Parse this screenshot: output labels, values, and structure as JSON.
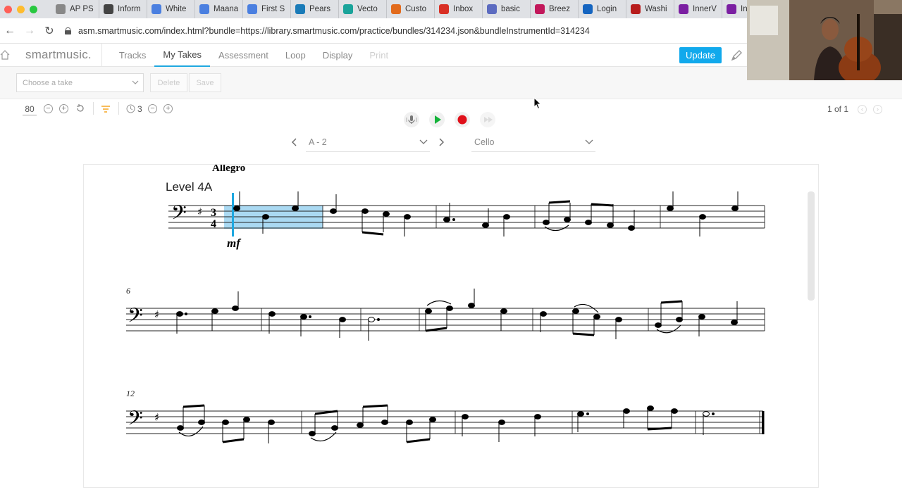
{
  "browser": {
    "tabs": [
      {
        "label": "AP PS",
        "icon": "gear-icon",
        "color": "#888888"
      },
      {
        "label": "Inform",
        "icon": "classroom-icon",
        "color": "#444444"
      },
      {
        "label": "White",
        "icon": "doc-icon",
        "color": "#4a7fe0"
      },
      {
        "label": "Maana",
        "icon": "doc-icon",
        "color": "#4a7fe0"
      },
      {
        "label": "First S",
        "icon": "doc-icon",
        "color": "#4a7fe0"
      },
      {
        "label": "Pears",
        "icon": "pearson-icon",
        "color": "#1a7bb8"
      },
      {
        "label": "Vecto",
        "icon": "vector-icon",
        "color": "#1aa39a"
      },
      {
        "label": "Custo",
        "icon": "etsy-icon",
        "color": "#e26b1d"
      },
      {
        "label": "Inbox",
        "icon": "gmail-icon",
        "color": "#d93025"
      },
      {
        "label": "basic",
        "icon": "basic-icon",
        "color": "#5c6bc0"
      },
      {
        "label": "Breez",
        "icon": "breeze-icon",
        "color": "#c2185b"
      },
      {
        "label": "Login",
        "icon": "login-icon",
        "color": "#1565c0"
      },
      {
        "label": "Washi",
        "icon": "washi-icon",
        "color": "#b71c1c"
      },
      {
        "label": "InnerV",
        "icon": "inner-icon",
        "color": "#7b1fa2"
      },
      {
        "label": "Inne",
        "icon": "inner-icon",
        "color": "#7b1fa2"
      }
    ],
    "url": "asm.smartmusic.com/index.html?bundle=https://library.smartmusic.com/practice/bundles/314234.json&bundleInstrumentId=314234"
  },
  "app": {
    "logo": "smartmusic.",
    "menu": [
      "Tracks",
      "My Takes",
      "Assessment",
      "Loop",
      "Display",
      "Print"
    ],
    "active_menu": "My Takes",
    "update_label": "Update",
    "take_placeholder": "Choose a take",
    "delete_label": "Delete",
    "save_label": "Save",
    "tempo": "80",
    "countoff": "3",
    "page_count": "1 of 1",
    "exercise": "A - 2",
    "instrument": "Cello"
  },
  "score": {
    "tempo_marking": "Allegro",
    "title": "Level 4A",
    "time_signature": "3/4",
    "key": "G major (1 sharp)",
    "clef": "bass",
    "dynamic": "mf",
    "system_numbers": [
      "6",
      "12"
    ]
  },
  "colors": {
    "accent": "#11a9ec",
    "highlight": "#aad9f2",
    "record": "#e0101a",
    "play": "#15b33a"
  }
}
